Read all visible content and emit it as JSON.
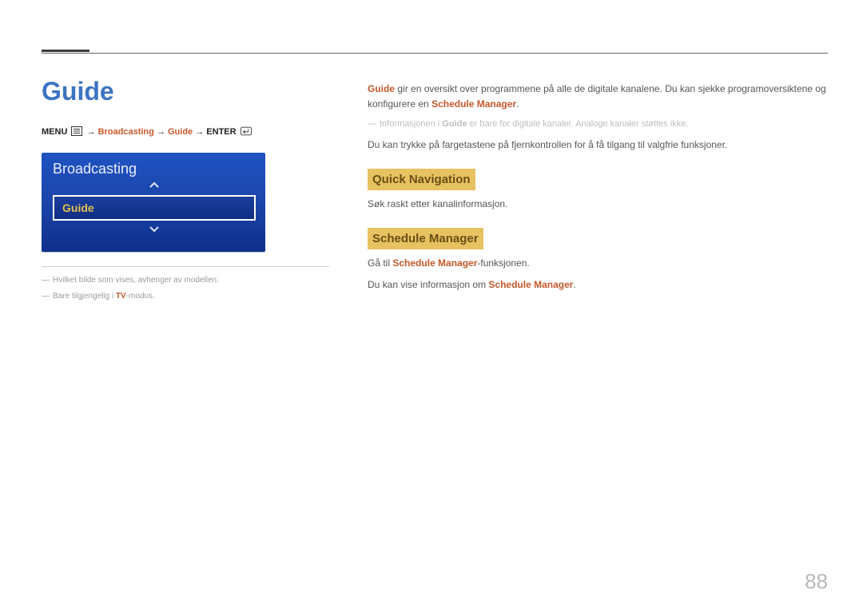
{
  "title": "Guide",
  "menupath": {
    "menu": "MENU",
    "arrow": "→",
    "broadcasting": "Broadcasting",
    "guide": "Guide",
    "enter": "ENTER"
  },
  "osd": {
    "title": "Broadcasting",
    "item": "Guide"
  },
  "footnotes": {
    "img_depends": "Hvilket bilde som vises, avhenger av modellen.",
    "tv_prefix": "Bare tilgjengelig i ",
    "tv_hl": "TV",
    "tv_suffix": "-modus."
  },
  "intro": {
    "guide_hl": "Guide",
    "text": " gir en oversikt over programmene på alle de digitale kanalene. Du kan sjekke programoversiktene og konfigurere en ",
    "sched_hl": "Schedule Manager",
    "period": "."
  },
  "note_digital": {
    "prefix": "Informasjonen i ",
    "guide_bold": "Guide",
    "suffix": " er bare for digitale kanaler. Analoge kanaler støttes ikke."
  },
  "remote_line": "Du kan trykke på fargetastene på fjernkontrollen for å få tilgang til valgfrie funksjoner.",
  "sections": {
    "quicknav_hd": "Quick Navigation",
    "quicknav_body": "Søk raskt etter kanalinformasjon.",
    "sched_hd": "Schedule Manager",
    "sched_l1_pre": "Gå til ",
    "sched_l1_hl": "Schedule Manager",
    "sched_l1_post": "-funksjonen.",
    "sched_l2_pre": "Du kan vise informasjon om ",
    "sched_l2_hl": "Schedule Manager",
    "sched_l2_post": "."
  },
  "page_number": "88"
}
